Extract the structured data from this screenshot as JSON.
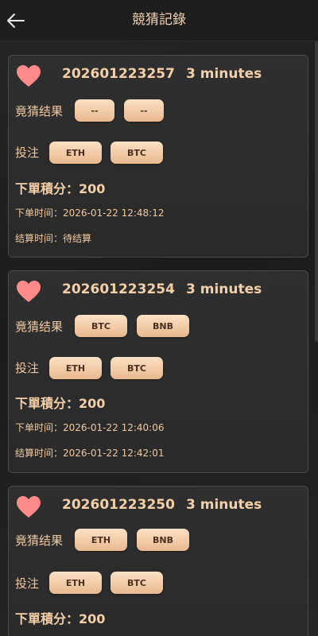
{
  "header": {
    "title": "競猜記錄"
  },
  "labels": {
    "result": "竟猜结果",
    "bet": "投注",
    "points": "下單積分：",
    "order_time": "下单时间：",
    "settle_time": "结算时间："
  },
  "records": [
    {
      "order_no": "202601223257",
      "duration": "3 minutes",
      "result": [
        "--",
        "--"
      ],
      "bet": [
        "ETH",
        "BTC"
      ],
      "points": "200",
      "order_time": "2026-01-22 12:48:12",
      "settle_time": "待结算"
    },
    {
      "order_no": "202601223254",
      "duration": "3 minutes",
      "result": [
        "BTC",
        "BNB"
      ],
      "bet": [
        "ETH",
        "BTC"
      ],
      "points": "200",
      "order_time": "2026-01-22 12:40:06",
      "settle_time": "2026-01-22 12:42:01"
    },
    {
      "order_no": "202601223250",
      "duration": "3 minutes",
      "result": [
        "ETH",
        "BNB"
      ],
      "bet": [
        "ETH",
        "BTC"
      ],
      "points": "200"
    }
  ],
  "icons": {
    "back": "arrow-left-icon",
    "favorite": "heart-icon"
  },
  "colors": {
    "accent": "#f5cfa8",
    "heart": "#ff8a8a",
    "pill_top": "#fbe1c5",
    "pill_bottom": "#e9b88e"
  }
}
